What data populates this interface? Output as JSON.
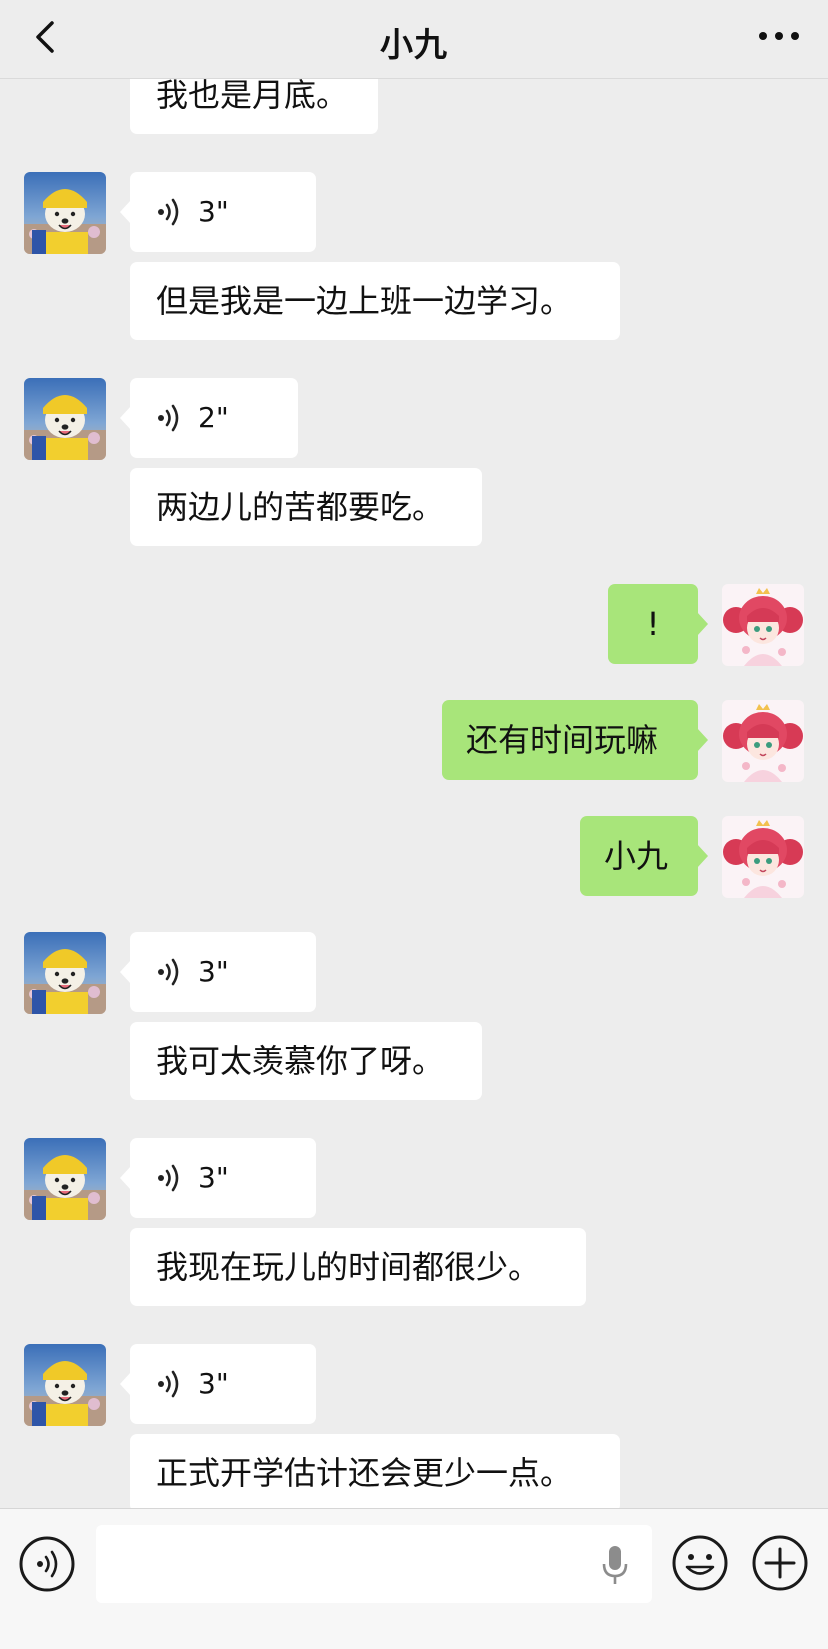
{
  "header": {
    "title": "小九",
    "back_icon": "chevron-left-icon",
    "more_icon": "more-dots-icon"
  },
  "colors": {
    "background": "#EDEDED",
    "incoming_bubble": "#FFFFFF",
    "outgoing_bubble": "#A8E57A"
  },
  "messages": {
    "m0_text": "我也是月底。",
    "m1_voice": "3\"",
    "m2_text": "但是我是一边上班一边学习。",
    "m3_voice": "2\"",
    "m4_text": "两边儿的苦都要吃。",
    "m5_text": "!",
    "m6_text": "还有时间玩嘛",
    "m7_text": "小九",
    "m8_voice": "3\"",
    "m9_text": "我可太羡慕你了呀。",
    "m10_voice": "3\"",
    "m11_text": "我现在玩儿的时间都很少。",
    "m12_voice": "3\"",
    "m13_text": "正式开学估计还会更少一点。"
  },
  "input_bar": {
    "voice_toggle_icon": "voice-toggle-icon",
    "input_value": "",
    "mic_icon": "microphone-icon",
    "emoji_icon": "emoji-icon",
    "plus_icon": "plus-icon"
  }
}
